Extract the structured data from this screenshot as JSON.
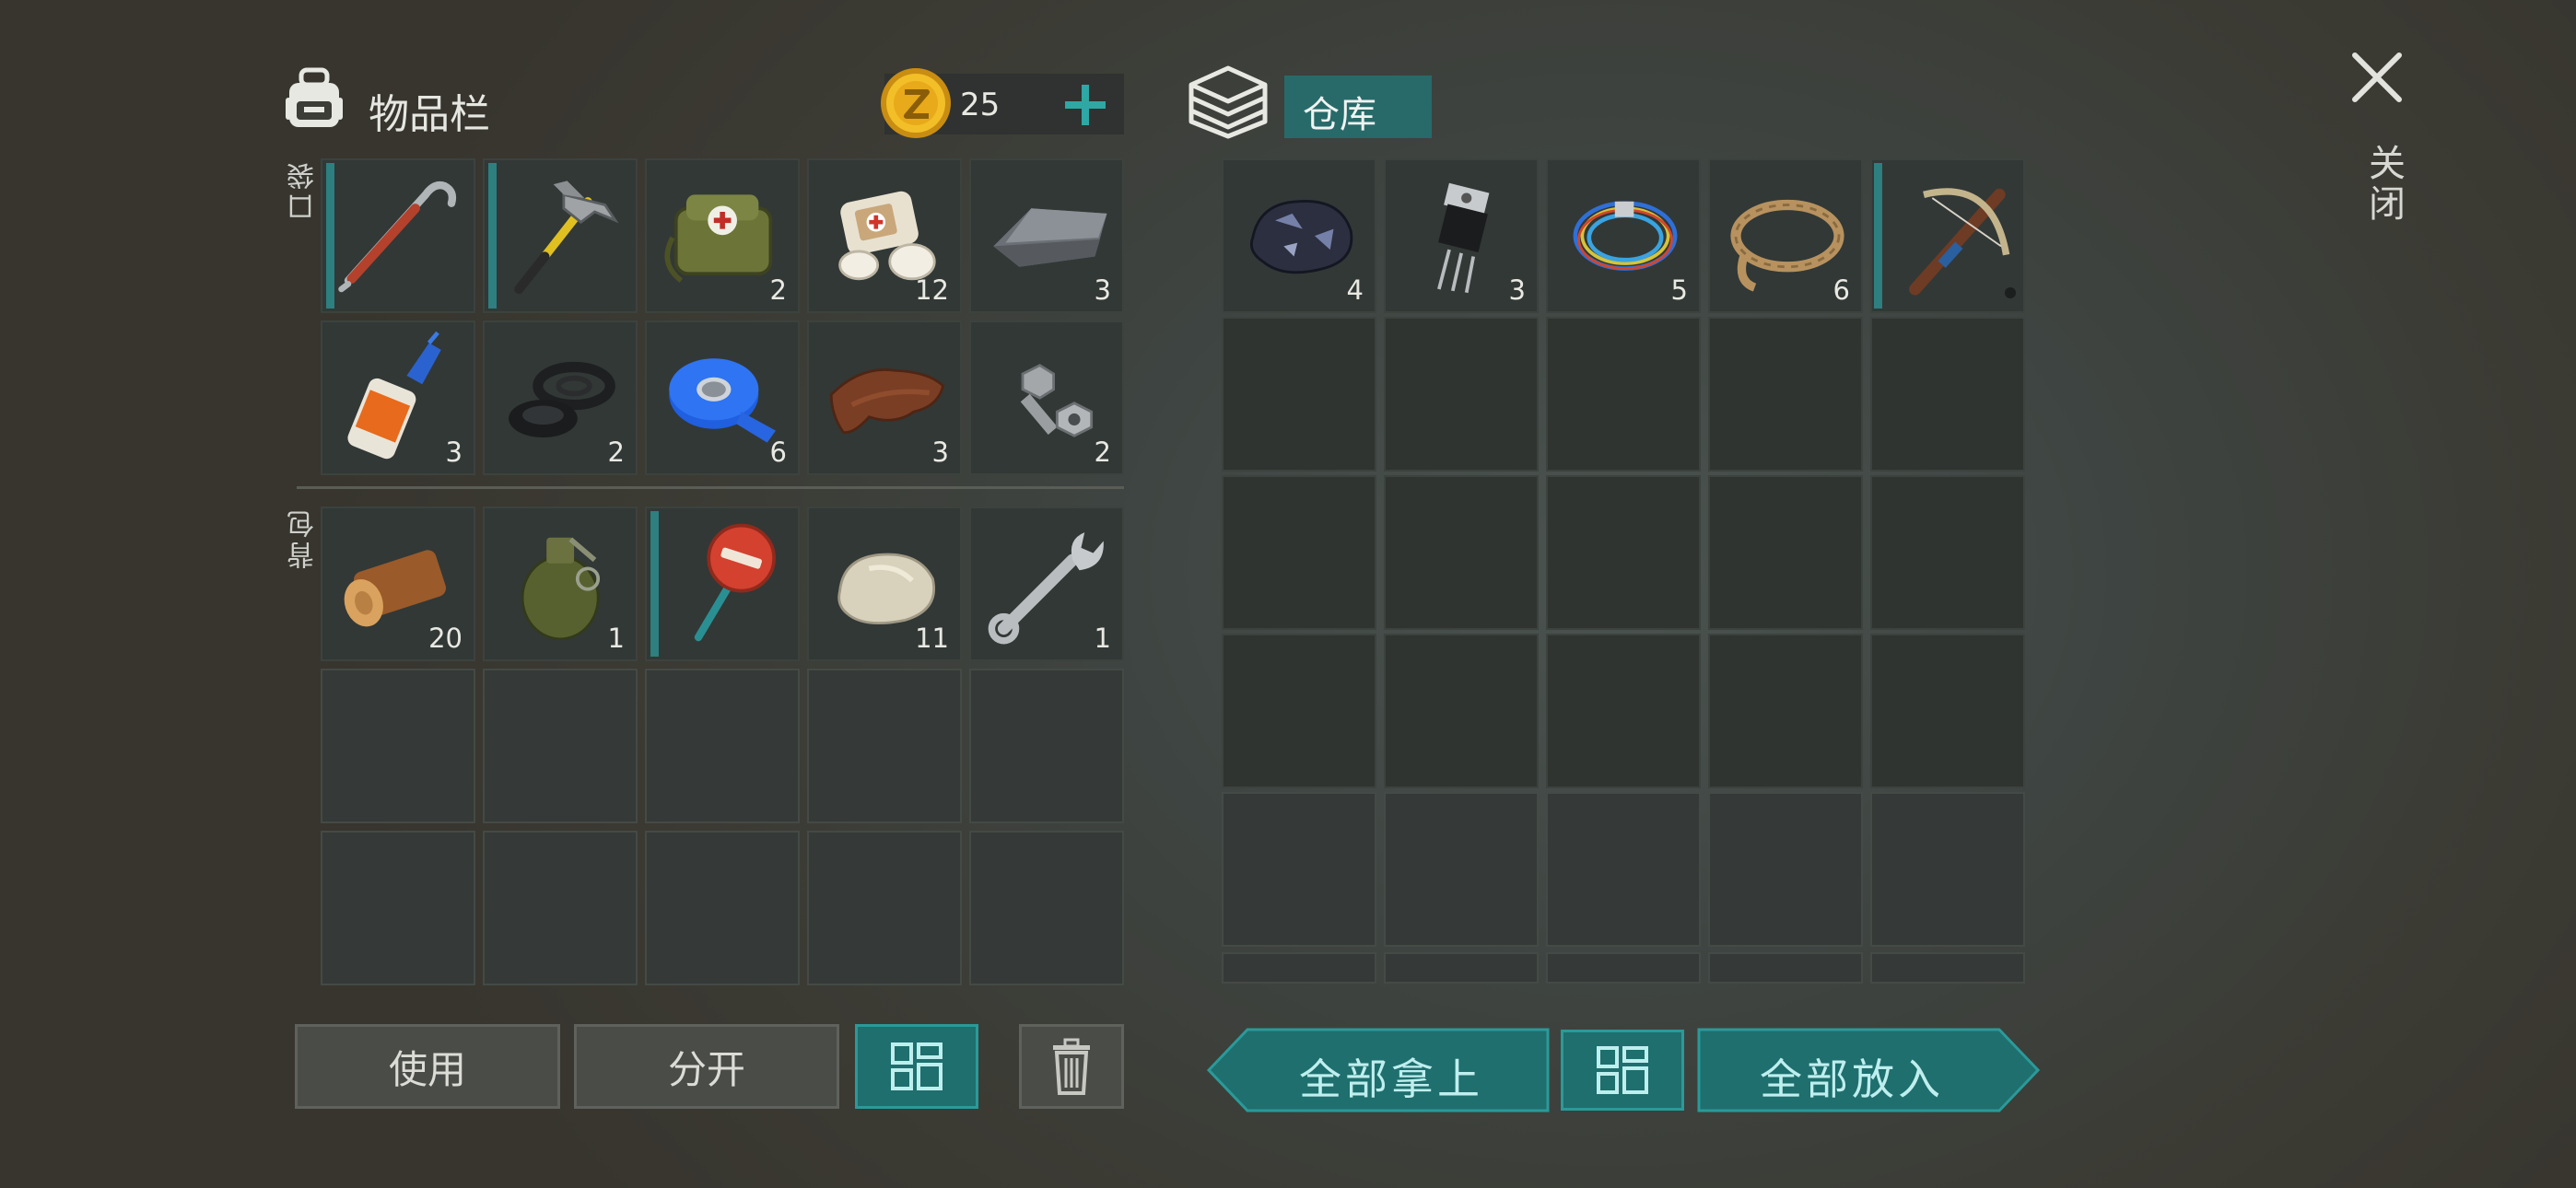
{
  "inventory": {
    "title": "物品栏",
    "coins": "25",
    "coin_symbol": "Z",
    "pockets_label": "口袋",
    "backpack_label": "背包",
    "pocket_items": [
      {
        "icon": "crowbar-icon",
        "count": ""
      },
      {
        "icon": "hammer-icon",
        "count": ""
      },
      {
        "icon": "first-aid-bag-icon",
        "count": "2"
      },
      {
        "icon": "bandage-icon",
        "count": "12"
      },
      {
        "icon": "metal-ingot-icon",
        "count": "3"
      },
      {
        "icon": "glue-tube-icon",
        "count": "3"
      },
      {
        "icon": "rubber-rings-icon",
        "count": "2"
      },
      {
        "icon": "duct-tape-icon",
        "count": "6"
      },
      {
        "icon": "leather-icon",
        "count": "3"
      },
      {
        "icon": "bolt-nut-icon",
        "count": "2"
      }
    ],
    "backpack_items": [
      {
        "icon": "log-icon",
        "count": "20"
      },
      {
        "icon": "grenade-icon",
        "count": "1"
      },
      {
        "icon": "stop-sign-icon",
        "count": ""
      },
      {
        "icon": "stone-icon",
        "count": "11"
      },
      {
        "icon": "wrench-icon",
        "count": "1"
      }
    ]
  },
  "storage": {
    "title": "仓库",
    "items": [
      {
        "icon": "ore-icon",
        "count": "4"
      },
      {
        "icon": "transistor-icon",
        "count": "3"
      },
      {
        "icon": "wires-icon",
        "count": "5"
      },
      {
        "icon": "rope-icon",
        "count": "6"
      },
      {
        "icon": "crossbow-icon",
        "count": ""
      }
    ]
  },
  "close_label": "关闭",
  "buttons": {
    "use": "使用",
    "split": "分开",
    "take_all": "全部拿上",
    "put_all": "全部放入"
  },
  "colors": {
    "accent_teal": "#1e6f6e",
    "durability_bar": "#2d7f80",
    "coin_gold": "#e8b21a"
  }
}
